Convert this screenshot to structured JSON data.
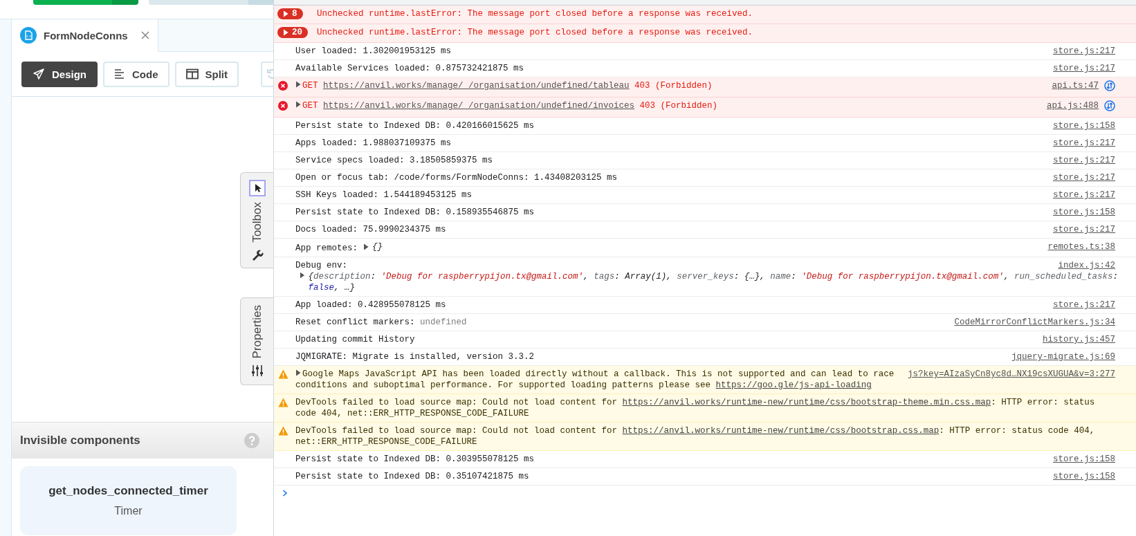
{
  "editor": {
    "tabs": [
      {
        "label": "FormNodeConns",
        "selected": true
      }
    ],
    "view_modes": [
      {
        "label": "Design",
        "selected": true
      },
      {
        "label": "Code",
        "selected": false
      },
      {
        "label": "Split",
        "selected": false
      }
    ],
    "side_tabs": [
      {
        "label": "Toolbox"
      },
      {
        "label": "Properties"
      }
    ],
    "invisible_components": {
      "title": "Invisible components",
      "items": [
        {
          "name": "get_nodes_connected_timer",
          "type": "Timer"
        }
      ]
    }
  },
  "console": {
    "messages": [
      {
        "kind": "error-group",
        "count": "8",
        "runs": [
          {
            "kind": "text",
            "text": "Unchecked runtime.lastError: The message port closed before a response was received."
          }
        ]
      },
      {
        "kind": "error-group",
        "count": "20",
        "runs": [
          {
            "kind": "text",
            "text": "Unchecked runtime.lastError: The message port closed before a response was received."
          }
        ]
      },
      {
        "kind": "log",
        "runs": [
          {
            "kind": "text",
            "text": "User loaded: 1.302001953125 ms"
          }
        ],
        "source": "store.js:217"
      },
      {
        "kind": "log",
        "runs": [
          {
            "kind": "text",
            "text": "Available Services loaded: 0.875732421875 ms"
          }
        ],
        "source": "store.js:217"
      },
      {
        "kind": "error",
        "expandable": true,
        "runs": [
          {
            "kind": "text",
            "text": "GET "
          },
          {
            "kind": "link",
            "text": "https://anvil.works/manage/_/organisation/undefined/tableau"
          },
          {
            "kind": "text",
            "text": " 403 (Forbidden)"
          }
        ],
        "source": "api.ts:47"
      },
      {
        "kind": "error",
        "expandable": true,
        "runs": [
          {
            "kind": "text",
            "text": "GET "
          },
          {
            "kind": "link",
            "text": "https://anvil.works/manage/_/organisation/undefined/invoices"
          },
          {
            "kind": "text",
            "text": " 403 (Forbidden)"
          }
        ],
        "source": "api.js:488"
      },
      {
        "kind": "log",
        "runs": [
          {
            "kind": "text",
            "text": "Persist state to Indexed DB: 0.420166015625 ms"
          }
        ],
        "source": "store.js:158"
      },
      {
        "kind": "log",
        "runs": [
          {
            "kind": "text",
            "text": "Apps loaded: 1.988037109375 ms"
          }
        ],
        "source": "store.js:217"
      },
      {
        "kind": "log",
        "runs": [
          {
            "kind": "text",
            "text": "Service specs loaded: 3.18505859375 ms"
          }
        ],
        "source": "store.js:217"
      },
      {
        "kind": "log",
        "runs": [
          {
            "kind": "text",
            "text": "Open or focus tab: /code/forms/FormNodeConns: 1.43408203125 ms"
          }
        ],
        "source": "store.js:217"
      },
      {
        "kind": "log",
        "runs": [
          {
            "kind": "text",
            "text": "SSH Keys loaded: 1.544189453125 ms"
          }
        ],
        "source": "store.js:217"
      },
      {
        "kind": "log",
        "runs": [
          {
            "kind": "text",
            "text": "Persist state to Indexed DB: 0.158935546875 ms"
          }
        ],
        "source": "store.js:158"
      },
      {
        "kind": "log",
        "runs": [
          {
            "kind": "text",
            "text": "Docs loaded: 75.9990234375 ms"
          }
        ],
        "source": "store.js:217"
      },
      {
        "kind": "log",
        "runs": [
          {
            "kind": "text",
            "text": "App remotes:"
          }
        ],
        "object": {
          "expandable": true,
          "new_line": false,
          "runs": [
            {
              "kind": "punct",
              "text": "{}"
            }
          ]
        },
        "source": "remotes.ts:38"
      },
      {
        "kind": "log",
        "runs": [
          {
            "kind": "text",
            "text": "Debug env:"
          }
        ],
        "object": {
          "expandable": true,
          "new_line": true,
          "runs": [
            {
              "kind": "punct",
              "text": "{"
            },
            {
              "kind": "key",
              "text": "description"
            },
            {
              "kind": "punct",
              "text": ": "
            },
            {
              "kind": "string",
              "text": "'Debug for raspberrypijon.tx@gmail.com'"
            },
            {
              "kind": "punct",
              "text": ", "
            },
            {
              "kind": "key",
              "text": "tags"
            },
            {
              "kind": "punct",
              "text": ": "
            },
            {
              "kind": "value",
              "text": "Array(1)"
            },
            {
              "kind": "punct",
              "text": ", "
            },
            {
              "kind": "key",
              "text": "server_keys"
            },
            {
              "kind": "punct",
              "text": ": "
            },
            {
              "kind": "value",
              "text": "{…}"
            },
            {
              "kind": "punct",
              "text": ", "
            },
            {
              "kind": "key",
              "text": "name"
            },
            {
              "kind": "punct",
              "text": ": "
            },
            {
              "kind": "string",
              "text": "'Debug for raspberrypijon.tx@gmail.com'"
            },
            {
              "kind": "punct",
              "text": ", "
            },
            {
              "kind": "key",
              "text": "run_scheduled_tasks"
            },
            {
              "kind": "punct",
              "text": ": "
            },
            {
              "kind": "bool",
              "text": "false"
            },
            {
              "kind": "punct",
              "text": ", …}"
            }
          ]
        },
        "source": "index.js:42"
      },
      {
        "kind": "log",
        "runs": [
          {
            "kind": "text",
            "text": "App loaded: 0.428955078125 ms"
          }
        ],
        "source": "store.js:217"
      },
      {
        "kind": "log",
        "runs": [
          {
            "kind": "text",
            "text": "Reset conflict markers: "
          },
          {
            "kind": "muted",
            "text": "undefined"
          }
        ],
        "source": "CodeMirrorConflictMarkers.js:34"
      },
      {
        "kind": "log",
        "runs": [
          {
            "kind": "text",
            "text": "Updating commit History"
          }
        ],
        "source": "history.js:457"
      },
      {
        "kind": "log",
        "runs": [
          {
            "kind": "text",
            "text": "JQMIGRATE: Migrate is installed, version 3.3.2"
          }
        ],
        "source": "jquery-migrate.js:69"
      },
      {
        "kind": "warning",
        "expandable": true,
        "runs": [
          {
            "kind": "text",
            "text": "Google Maps JavaScript API has been loaded directly without a callback. This is not supported and can lead to race conditions and suboptimal performance. For supported loading patterns please see "
          },
          {
            "kind": "link",
            "text": "https://goo.gle/js-api-loading"
          }
        ],
        "source": "js?key=AIzaSyCn8yc8d…NX19csXUGUA&v=3:277"
      },
      {
        "kind": "warning",
        "runs": [
          {
            "kind": "text",
            "text": "DevTools failed to load source map: Could not load content for "
          },
          {
            "kind": "link",
            "text": "https://anvil.works/runtime-new/runtime/css/bootstrap-theme.min.css.map"
          },
          {
            "kind": "text",
            "text": ": HTTP error: status code 404, net::ERR_HTTP_RESPONSE_CODE_FAILURE"
          }
        ]
      },
      {
        "kind": "warning",
        "runs": [
          {
            "kind": "text",
            "text": "DevTools failed to load source map: Could not load content for "
          },
          {
            "kind": "link",
            "text": "https://anvil.works/runtime-new/runtime/css/bootstrap.css.map"
          },
          {
            "kind": "text",
            "text": ": HTTP error: status code 404, net::ERR_HTTP_RESPONSE_CODE_FAILURE"
          }
        ]
      },
      {
        "kind": "log",
        "runs": [
          {
            "kind": "text",
            "text": "Persist state to Indexed DB: 0.303955078125 ms"
          }
        ],
        "source": "store.js:158"
      },
      {
        "kind": "log",
        "runs": [
          {
            "kind": "text",
            "text": "Persist state to Indexed DB: 0.35107421875 ms"
          }
        ],
        "source": "store.js:158"
      }
    ]
  }
}
